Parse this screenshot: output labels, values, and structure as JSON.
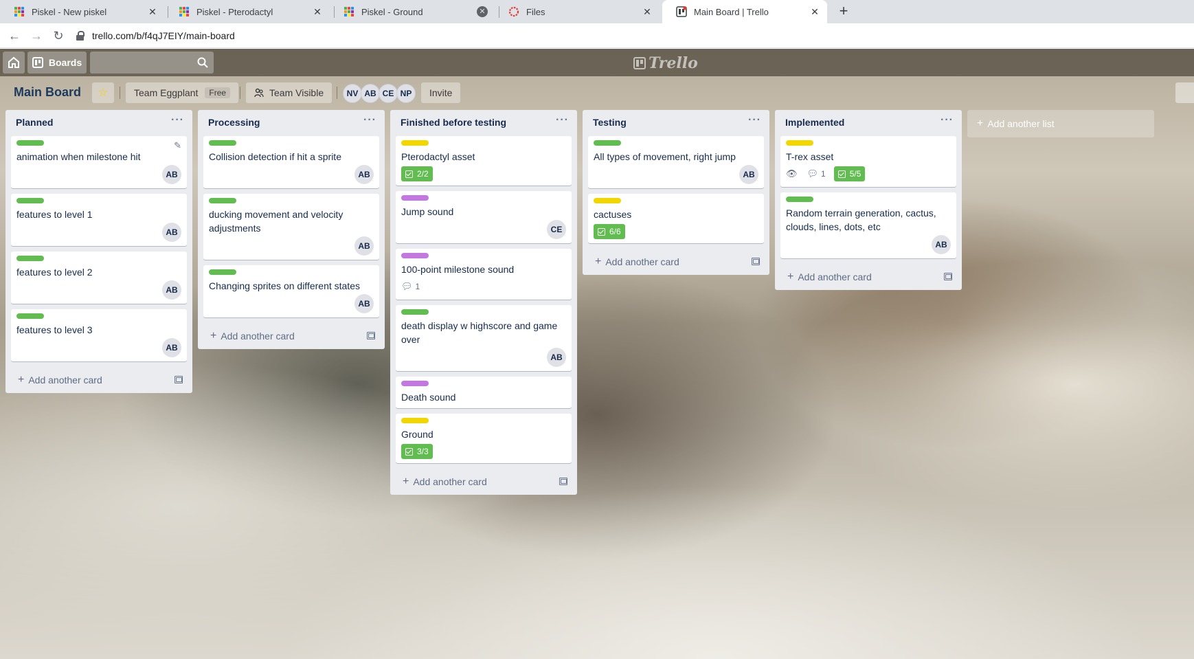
{
  "browser": {
    "tabs": [
      {
        "title": "Piskel - New piskel",
        "icon": "piskel-grid-icon"
      },
      {
        "title": "Piskel - Pterodactyl",
        "icon": "piskel-grid-icon"
      },
      {
        "title": "Piskel - Ground",
        "icon": "piskel-grid-icon"
      },
      {
        "title": "Files",
        "icon": "files-ring-icon"
      },
      {
        "title": "Main Board | Trello",
        "icon": "trello-favicon"
      }
    ],
    "url": "trello.com/b/f4qJ7EIY/main-board"
  },
  "header": {
    "boards_label": "Boards",
    "logo_text": "Trello"
  },
  "board": {
    "title": "Main Board",
    "team": "Team Eggplant",
    "team_plan": "Free",
    "visibility": "Team Visible",
    "members": [
      "NV",
      "AB",
      "CE",
      "NP"
    ],
    "invite_label": "Invite",
    "add_list_label": "Add another list",
    "add_card_label": "Add another card"
  },
  "colors": {
    "green": "#61bd4f",
    "yellow": "#f2d600",
    "purple": "#c377e0"
  },
  "lists": [
    {
      "name": "Planned",
      "cards": [
        {
          "label": "green",
          "title": "animation when milestone hit",
          "member": "AB"
        },
        {
          "label": "green",
          "title": "features to level 1",
          "member": "AB"
        },
        {
          "label": "green",
          "title": "features to level 2",
          "member": "AB"
        },
        {
          "label": "green",
          "title": "features to level 3",
          "member": "AB"
        }
      ]
    },
    {
      "name": "Processing",
      "cards": [
        {
          "label": "green",
          "title": "Collision detection if hit a sprite",
          "member": "AB"
        },
        {
          "label": "green",
          "title": "ducking movement and velocity adjustments",
          "member": "AB"
        },
        {
          "label": "green",
          "title": "Changing sprites on different states",
          "member": "AB"
        }
      ]
    },
    {
      "name": "Finished before testing",
      "cards": [
        {
          "label": "yellow",
          "title": "Pterodactyl asset",
          "checklist": "2/2"
        },
        {
          "label": "purple",
          "title": "Jump sound",
          "member": "CE"
        },
        {
          "label": "purple",
          "title": "100-point milestone sound",
          "comments": "1"
        },
        {
          "label": "green",
          "title": "death display w highscore and game over",
          "member": "AB"
        },
        {
          "label": "purple",
          "title": "Death sound"
        },
        {
          "label": "yellow",
          "title": "Ground",
          "checklist": "3/3"
        }
      ]
    },
    {
      "name": "Testing",
      "cards": [
        {
          "label": "green",
          "title": "All types of movement, right jump",
          "member": "AB"
        },
        {
          "label": "yellow",
          "title": "cactuses",
          "checklist": "6/6"
        }
      ]
    },
    {
      "name": "Implemented",
      "cards": [
        {
          "label": "yellow",
          "title": "T-rex asset",
          "comments": "1",
          "checklist": "5/5"
        },
        {
          "label": "green",
          "title": "Random terrain generation, cactus, clouds, lines, dots, etc",
          "member": "AB"
        }
      ]
    }
  ]
}
